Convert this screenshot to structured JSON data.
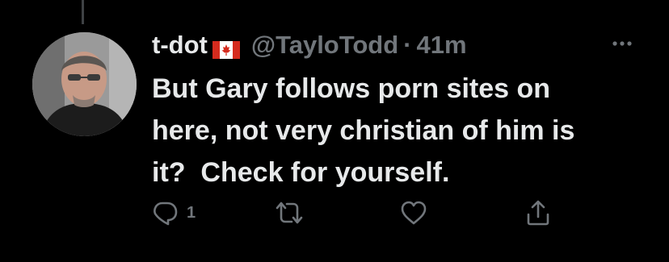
{
  "tweet": {
    "display_name": "t-dot",
    "handle": "@TayloTodd",
    "separator": "·",
    "time": "41m",
    "text": "But Gary follows porn sites on\nhere, not very christian of him is\nit?  Check for yourself.",
    "reply_count": "1"
  },
  "icons": {
    "flag": "canada-flag-icon",
    "more": "more-icon",
    "reply": "reply-icon",
    "retweet": "retweet-icon",
    "like": "like-icon",
    "share": "share-icon"
  },
  "colors": {
    "background": "#000000",
    "text": "#e7e9ea",
    "muted": "#71767b",
    "flag_red": "#d52b1e"
  }
}
